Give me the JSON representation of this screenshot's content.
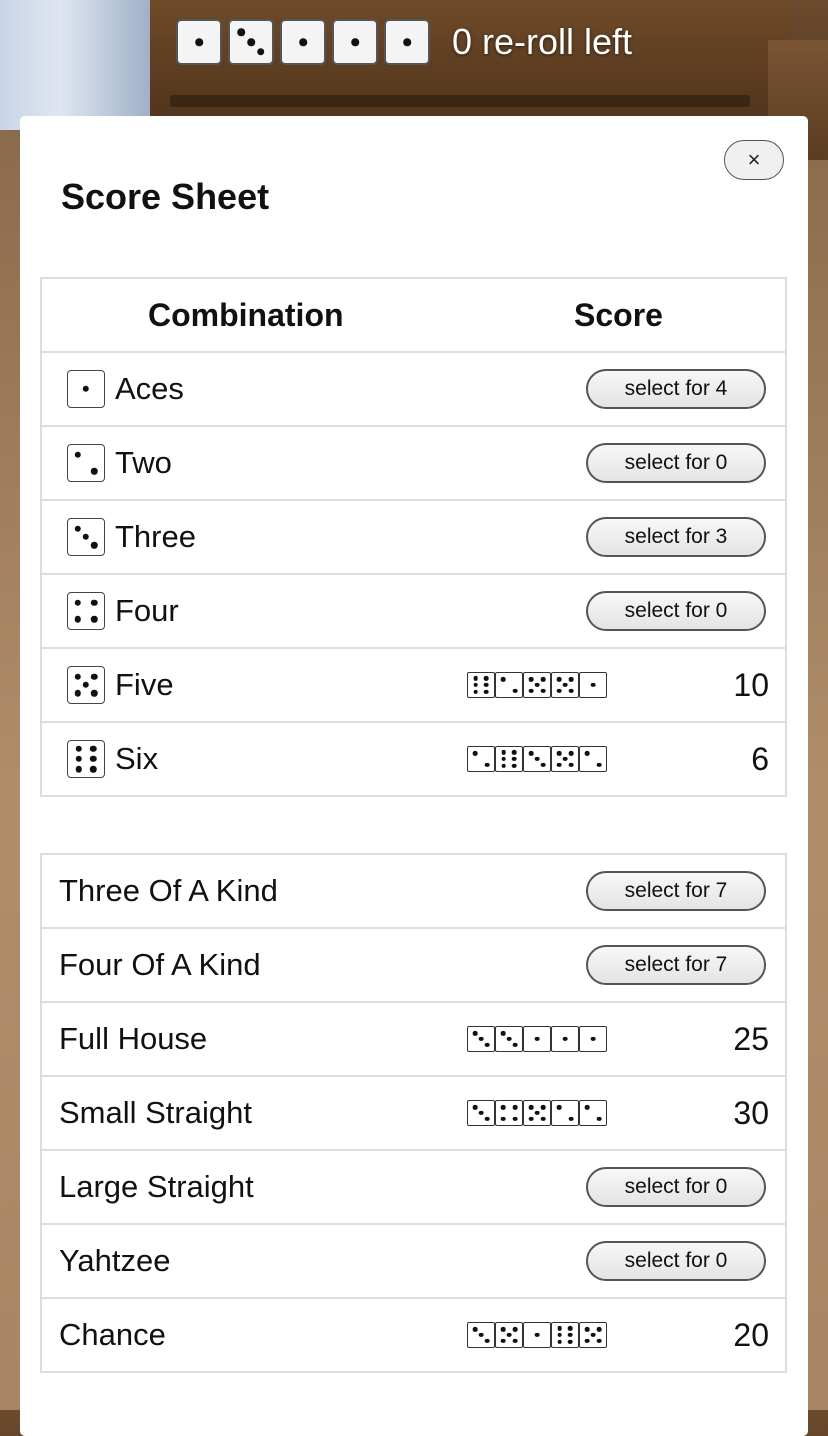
{
  "hud": {
    "dice": [
      1,
      3,
      1,
      1,
      1
    ],
    "reroll_text": "0 re-roll left"
  },
  "modal": {
    "title": "Score Sheet",
    "close_label": "×",
    "header": {
      "combination": "Combination",
      "score": "Score"
    },
    "upper": [
      {
        "name": "Aces",
        "face": 1,
        "button": "select for 4"
      },
      {
        "name": "Two",
        "face": 2,
        "button": "select for 0"
      },
      {
        "name": "Three",
        "face": 3,
        "button": "select for 3"
      },
      {
        "name": "Four",
        "face": 4,
        "button": "select for 0"
      },
      {
        "name": "Five",
        "face": 5,
        "dice": [
          6,
          2,
          5,
          5,
          1
        ],
        "score": "10"
      },
      {
        "name": "Six",
        "face": 6,
        "dice": [
          2,
          6,
          3,
          5,
          2
        ],
        "score": "6"
      }
    ],
    "lower": [
      {
        "name": "Three Of A Kind",
        "button": "select for 7"
      },
      {
        "name": "Four Of A Kind",
        "button": "select for 7"
      },
      {
        "name": "Full House",
        "dice": [
          3,
          3,
          1,
          1,
          1
        ],
        "score": "25"
      },
      {
        "name": "Small Straight",
        "dice": [
          3,
          4,
          5,
          2,
          2
        ],
        "score": "30"
      },
      {
        "name": "Large Straight",
        "button": "select for 0"
      },
      {
        "name": "Yahtzee",
        "button": "select for 0"
      },
      {
        "name": "Chance",
        "dice": [
          3,
          5,
          1,
          6,
          5
        ],
        "score": "20"
      }
    ]
  }
}
